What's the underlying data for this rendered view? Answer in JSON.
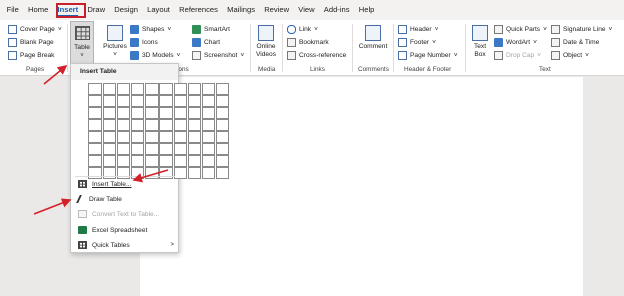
{
  "tabs": [
    "File",
    "Home",
    "Insert",
    "Draw",
    "Design",
    "Layout",
    "References",
    "Mailings",
    "Review",
    "View",
    "Add-ins",
    "Help"
  ],
  "active_tab": "Insert",
  "ribbon": {
    "pages": {
      "cover_page": "Cover Page",
      "blank_page": "Blank Page",
      "page_break": "Page Break",
      "group": "Pages"
    },
    "tables": {
      "table": "Table"
    },
    "illustrations": {
      "pictures": "Pictures",
      "shapes": "Shapes",
      "icons": "Icons",
      "models": "3D Models",
      "smartart": "SmartArt",
      "chart": "Chart",
      "screenshot": "Screenshot",
      "group_partial": "ions"
    },
    "media": {
      "online_videos_1": "Online",
      "online_videos_2": "Videos",
      "group": "Media"
    },
    "links": {
      "link": "Link",
      "bookmark": "Bookmark",
      "cross_reference": "Cross-reference",
      "group": "Links"
    },
    "comments": {
      "comment": "Comment",
      "group": "Comments"
    },
    "header_footer": {
      "header": "Header",
      "footer": "Footer",
      "page_number": "Page Number",
      "group": "Header & Footer"
    },
    "text": {
      "text_box_1": "Text",
      "text_box_2": "Box",
      "quick_parts": "Quick Parts",
      "wordart": "WordArt",
      "drop_cap": "Drop Cap",
      "signature_line": "Signature Line",
      "date_time": "Date & Time",
      "object": "Object",
      "group": "Text"
    }
  },
  "dropdown": {
    "title": "Insert Table",
    "grid_columns": 10,
    "grid_rows": 8,
    "items": [
      {
        "label": "Insert Table...",
        "icon": "table-icon",
        "disabled": false
      },
      {
        "label": "Draw Table",
        "icon": "pencil-icon",
        "disabled": false
      },
      {
        "label": "Convert Text to Table...",
        "icon": "convert-icon",
        "disabled": true
      },
      {
        "label": "Excel Spreadsheet",
        "icon": "excel-icon",
        "disabled": false
      },
      {
        "label": "Quick Tables",
        "icon": "table-icon",
        "disabled": false,
        "submenu": true
      }
    ]
  },
  "colors": {
    "accent": "#1e5fae",
    "highlight": "#c8202a",
    "annotation_arrow": "#d32029"
  }
}
